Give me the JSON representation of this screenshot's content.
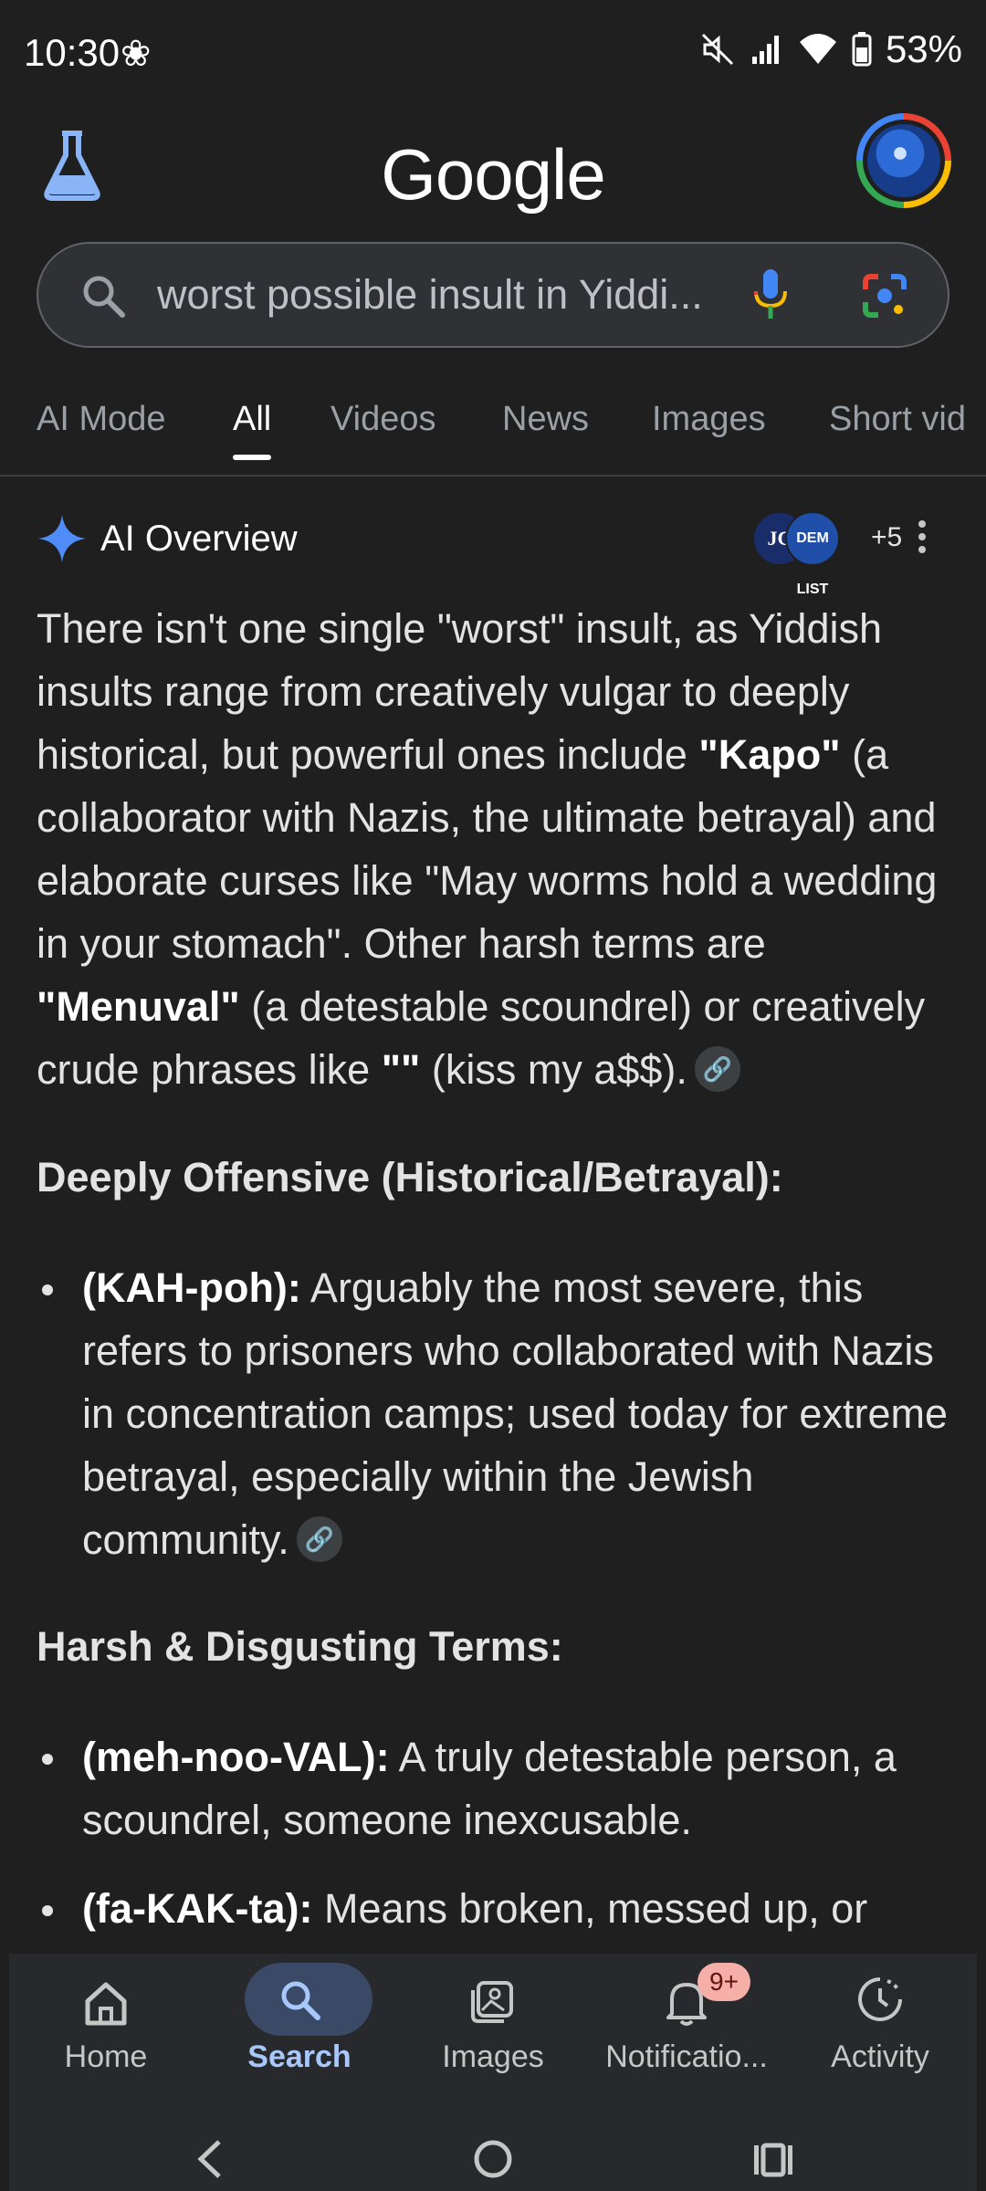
{
  "status_bar": {
    "time": "10:30",
    "battery": "53%"
  },
  "header": {
    "logo": "Google"
  },
  "search": {
    "query": "worst possible insult in Yiddi..."
  },
  "tabs": [
    "AI Mode",
    "All",
    "Videos",
    "News",
    "Images",
    "Short vid"
  ],
  "ai_overview": {
    "title": "AI Overview",
    "sources": {
      "src1": "JC",
      "src2": "DEM LIST",
      "more": "+5"
    },
    "intro": {
      "p1": "There isn't one single \"worst\" insult, as Yiddish insults range from creatively vulgar to deeply historical, but powerful ones include ",
      "b1": "\"Kapo\"",
      "p2": " (a collaborator with Nazis, the ultimate betrayal) and elaborate curses like \"May worms hold a wedding in your stomach\". Other harsh terms are ",
      "b2": "\"Menuval\"",
      "p3": " (a detestable scoundrel) or creatively crude phrases like ",
      "b3": "\"\"",
      "p4": " (kiss my a$$)."
    },
    "section1": {
      "heading": "Deeply Offensive (Historical/Betrayal):",
      "item1_term": "(KAH-poh):",
      "item1_text": " Arguably the most severe, this refers to prisoners who collaborated with Nazis in concentration camps; used today for extreme betrayal, especially within the Jewish community."
    },
    "section2": {
      "heading": "Harsh & Disgusting Terms:",
      "item1_term": "(meh-noo-VAL):",
      "item1_text": " A truly detestable person, a scoundrel, someone inexcusable.",
      "item2_term": "(fa-KAK-ta):",
      "item2_text": " Means broken, messed up, or"
    }
  },
  "bottom_nav": {
    "home": "Home",
    "search": "Search",
    "images": "Images",
    "notifications": "Notificatio...",
    "notifications_badge": "9+",
    "activity": "Activity"
  },
  "colors": {
    "background": "#1f1f1f",
    "accent": "#a8c7fa",
    "badge": "#f6aea9"
  }
}
